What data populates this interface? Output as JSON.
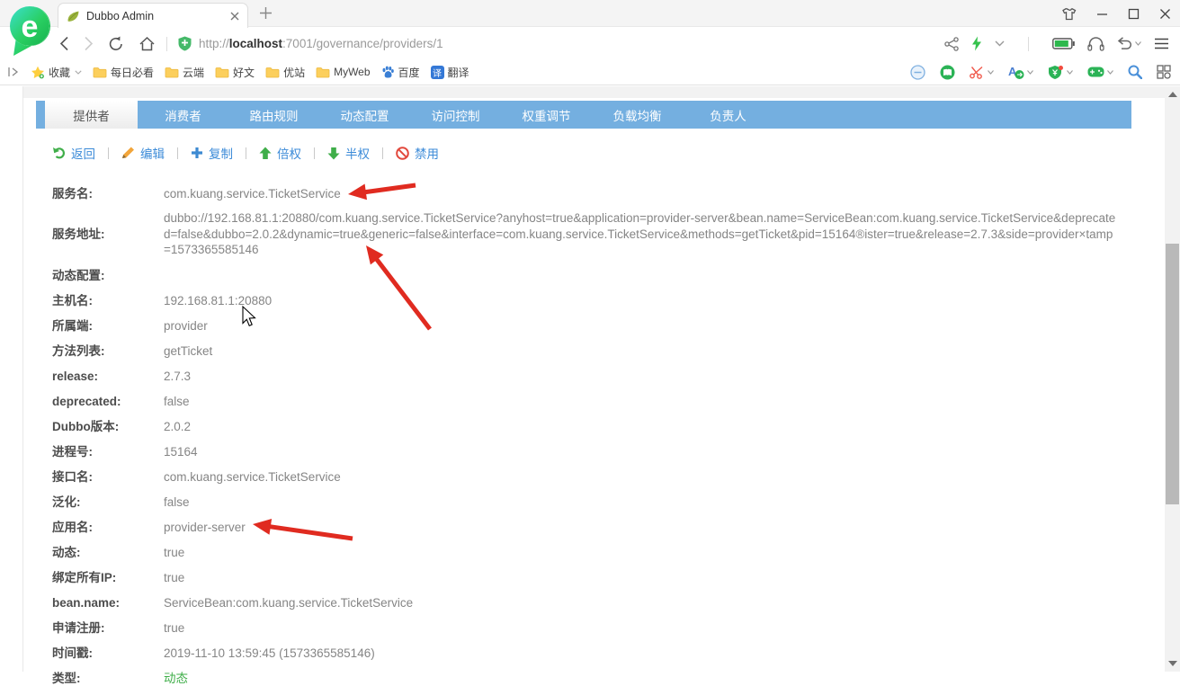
{
  "browser": {
    "tab_title": "Dubbo Admin",
    "url": {
      "scheme": "http://",
      "host": "localhost",
      "path": ":7001/governance/providers/1"
    }
  },
  "bookmarks": {
    "favorites_label": "收藏",
    "folders": [
      "每日必看",
      "云端",
      "好文",
      "优站",
      "MyWeb"
    ],
    "baidu_label": "百度",
    "translate_label": "翻译",
    "translate_glyph": "译"
  },
  "nav_tabs": [
    {
      "label": "提供者",
      "active": true
    },
    {
      "label": "消费者",
      "active": false
    },
    {
      "label": "路由规则",
      "active": false
    },
    {
      "label": "动态配置",
      "active": false
    },
    {
      "label": "访问控制",
      "active": false
    },
    {
      "label": "权重调节",
      "active": false
    },
    {
      "label": "负载均衡",
      "active": false
    },
    {
      "label": "负责人",
      "active": false
    }
  ],
  "actions": [
    {
      "label": "返回"
    },
    {
      "label": "编辑"
    },
    {
      "label": "复制"
    },
    {
      "label": "倍权"
    },
    {
      "label": "半权"
    },
    {
      "label": "禁用"
    }
  ],
  "fields": [
    {
      "label": "服务名:",
      "value": "com.kuang.service.TicketService"
    },
    {
      "label": "服务地址:",
      "value": "dubbo://192.168.81.1:20880/com.kuang.service.TicketService?anyhost=true&application=provider-server&bean.name=ServiceBean:com.kuang.service.TicketService&deprecated=false&dubbo=2.0.2&dynamic=true&generic=false&interface=com.kuang.service.TicketService&methods=getTicket&pid=15164®ister=true&release=2.7.3&side=provider×tamp=1573365585146"
    },
    {
      "label": "动态配置:",
      "value": ""
    },
    {
      "label": "主机名:",
      "value": "192.168.81.1:20880"
    },
    {
      "label": "所属端:",
      "value": "provider"
    },
    {
      "label": "方法列表:",
      "value": "getTicket"
    },
    {
      "label": "release:",
      "value": "2.7.3"
    },
    {
      "label": "deprecated:",
      "value": "false"
    },
    {
      "label": "Dubbo版本:",
      "value": "2.0.2"
    },
    {
      "label": "进程号:",
      "value": "15164"
    },
    {
      "label": "接口名:",
      "value": "com.kuang.service.TicketService"
    },
    {
      "label": "泛化:",
      "value": "false"
    },
    {
      "label": "应用名:",
      "value": "provider-server"
    },
    {
      "label": "动态:",
      "value": "true"
    },
    {
      "label": "绑定所有IP:",
      "value": "true"
    },
    {
      "label": "bean.name:",
      "value": "ServiceBean:com.kuang.service.TicketService"
    },
    {
      "label": "申请注册:",
      "value": "true"
    },
    {
      "label": "时间戳:",
      "value": "2019-11-10 13:59:45 (1573365585146)"
    },
    {
      "label": "类型:",
      "value": "动态"
    }
  ],
  "colors": {
    "nav_bar_blue": "#74afe0",
    "link_blue": "#3c8bd8",
    "annotation_arrow_red": "#e02b20",
    "type_value_green": "#3fae49"
  }
}
